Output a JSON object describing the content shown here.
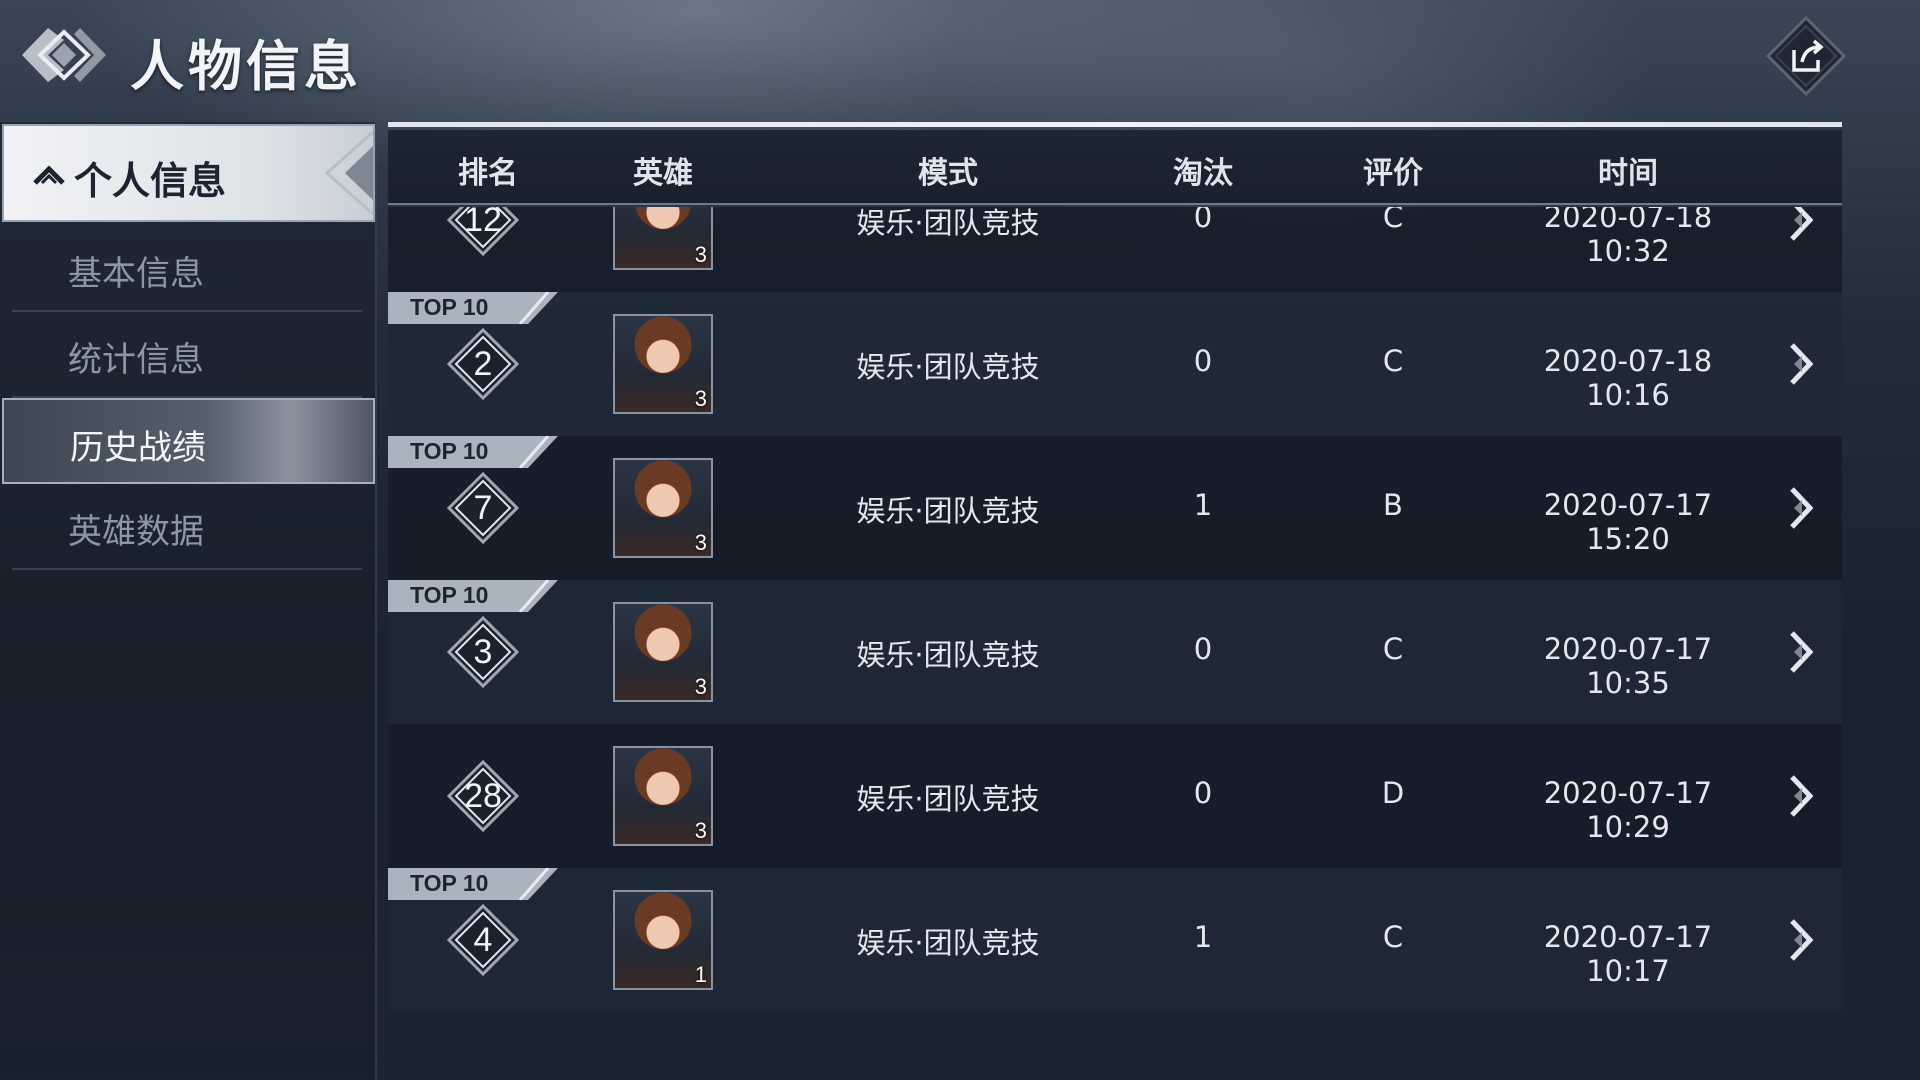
{
  "header": {
    "title": "人物信息",
    "share_icon": "share-icon"
  },
  "sidebar": {
    "section_label": "个人信息",
    "items": [
      {
        "label": "基本信息",
        "active": false
      },
      {
        "label": "统计信息",
        "active": false
      },
      {
        "label": "历史战绩",
        "active": true
      },
      {
        "label": "英雄数据",
        "active": false
      }
    ]
  },
  "table": {
    "columns": [
      "排名",
      "英雄",
      "模式",
      "淘汰",
      "评价",
      "时间"
    ],
    "top_badge_label": "TOP 10",
    "rows": [
      {
        "rank": "12",
        "top10": false,
        "hero_level": "3",
        "mode": "娱乐·团队竞技",
        "eliminations": "0",
        "rating": "C",
        "time": "2020-07-18 10:32"
      },
      {
        "rank": "2",
        "top10": true,
        "hero_level": "3",
        "mode": "娱乐·团队竞技",
        "eliminations": "0",
        "rating": "C",
        "time": "2020-07-18 10:16"
      },
      {
        "rank": "7",
        "top10": true,
        "hero_level": "3",
        "mode": "娱乐·团队竞技",
        "eliminations": "1",
        "rating": "B",
        "time": "2020-07-17 15:20"
      },
      {
        "rank": "3",
        "top10": true,
        "hero_level": "3",
        "mode": "娱乐·团队竞技",
        "eliminations": "0",
        "rating": "C",
        "time": "2020-07-17 10:35"
      },
      {
        "rank": "28",
        "top10": false,
        "hero_level": "3",
        "mode": "娱乐·团队竞技",
        "eliminations": "0",
        "rating": "D",
        "time": "2020-07-17 10:29"
      },
      {
        "rank": "4",
        "top10": true,
        "hero_level": "1",
        "mode": "娱乐·团队竞技",
        "eliminations": "1",
        "rating": "C",
        "time": "2020-07-17 10:17"
      }
    ]
  }
}
